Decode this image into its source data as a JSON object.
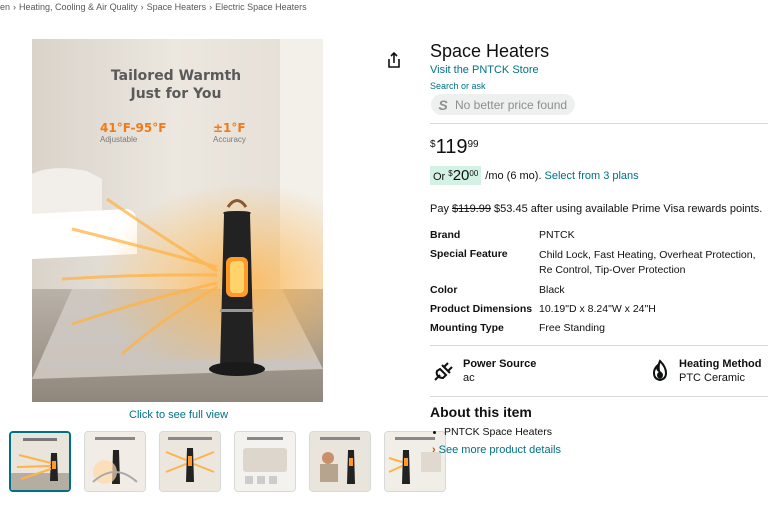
{
  "breadcrumb": [
    "en",
    "Heating, Cooling & Air Quality",
    "Space Heaters",
    "Electric Space Heaters"
  ],
  "breadcrumb_sep": "›",
  "image": {
    "headline_line1": "Tailored Warmth",
    "headline_line2": "Just for You",
    "range": "41°F-95°F",
    "range_sub": "Adjustable",
    "accuracy": "±1°F",
    "accuracy_sub": "Accuracy",
    "full_view_link": "Click to see full view",
    "thumbnail_count": 6
  },
  "product": {
    "title": "Space Heaters",
    "store_link": "Visit the PNTCK Store",
    "search_ask": "Search or ask",
    "price_pill": "No better price found",
    "price": {
      "symbol": "$",
      "whole": "119",
      "fraction": "99"
    },
    "monthly": {
      "or": "Or",
      "symbol": "$",
      "whole": "20",
      "fraction": "00",
      "text": "/mo (6 mo).",
      "link": "Select from 3 plans"
    },
    "pay_line": {
      "prefix": "Pay",
      "old_price": "$119.99",
      "suffix": "$53.45 after using available Prime Visa rewards points."
    }
  },
  "specs": [
    {
      "label": "Brand",
      "value": "PNTCK"
    },
    {
      "label": "Special Feature",
      "value": "Child Lock, Fast Heating, Overheat Protection, Re Control, Tip-Over Protection"
    },
    {
      "label": "Color",
      "value": "Black"
    },
    {
      "label": "Product Dimensions",
      "value": "10.19\"D x 8.24\"W x 24\"H"
    },
    {
      "label": "Mounting Type",
      "value": "Free Standing"
    }
  ],
  "features": [
    {
      "name": "Power Source",
      "value": "ac",
      "icon": "plug-icon"
    },
    {
      "name": "Heating Method",
      "value": "PTC Ceramic",
      "icon": "flame-icon"
    }
  ],
  "about": {
    "title": "About this item",
    "bullets": [
      "PNTCK Space Heaters"
    ],
    "see_more": "See more product details"
  },
  "colors": {
    "link": "#007185",
    "accent_orange": "#f07a17",
    "highlight_green": "#d4f1e6",
    "thumb_active": "#007185"
  }
}
